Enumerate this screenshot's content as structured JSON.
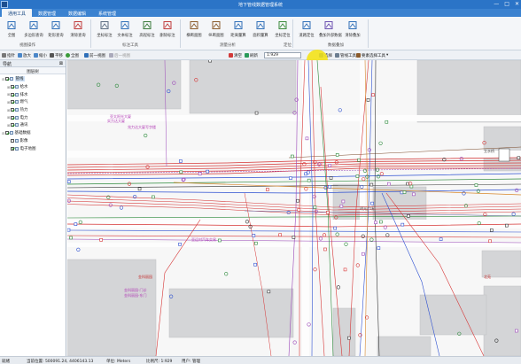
{
  "window": {
    "title": "地下管线数据管理系统",
    "controls": [
      "—",
      "□",
      "✕"
    ]
  },
  "tabs": [
    {
      "label": "通用工具",
      "active": true
    },
    {
      "label": "数据管理",
      "active": false
    },
    {
      "label": "数据编辑",
      "active": false
    },
    {
      "label": "系统管理",
      "active": false
    }
  ],
  "ribbon": {
    "buttons": [
      {
        "label": "全图",
        "icon": "full-extent-icon"
      },
      {
        "label": "多边形查询",
        "icon": "polygon-query-icon"
      },
      {
        "label": "矩形查询",
        "icon": "rect-query-icon"
      },
      {
        "label": "清除查询",
        "icon": "clear-query-icon"
      },
      {
        "label": "坐标标注",
        "icon": "coord-label-icon"
      },
      {
        "label": "文本标注",
        "icon": "text-label-icon"
      },
      {
        "label": "高程标注",
        "icon": "elevation-label-icon"
      },
      {
        "label": "删除标注",
        "icon": "delete-label-icon"
      },
      {
        "label": "横断面图",
        "icon": "cross-section-icon"
      },
      {
        "label": "纵断面图",
        "icon": "profile-icon"
      },
      {
        "label": "距离量算",
        "icon": "distance-measure-icon"
      },
      {
        "label": "面积量算",
        "icon": "area-measure-icon"
      },
      {
        "label": "坐标定位",
        "icon": "coord-locate-icon"
      },
      {
        "label": "道路定位",
        "icon": "road-locate-icon"
      },
      {
        "label": "叠加外部数据",
        "icon": "overlay-data-icon"
      },
      {
        "label": "清除叠加",
        "icon": "clear-overlay-icon"
      }
    ],
    "groups": [
      "视图操作",
      "标注工具",
      "测量分析",
      "定位",
      "数据叠加"
    ]
  },
  "map_toolbar": {
    "items": [
      "指针",
      "放大",
      "缩小",
      "平移",
      "全图",
      "前一视图",
      "后一视图",
      "清空",
      "刷新"
    ],
    "scale_value": "1:929",
    "right_items": [
      "选择",
      "管线工具",
      "要素选择工具"
    ]
  },
  "nav": {
    "title": "导航",
    "pin": "⊠",
    "subtitle": "图层树",
    "tree": [
      {
        "label": "管线",
        "level": 0,
        "exp": "⊟",
        "checked": true,
        "selected": true
      },
      {
        "label": "给水",
        "level": 1,
        "exp": "⊞",
        "checked": true
      },
      {
        "label": "排水",
        "level": 1,
        "exp": "⊞",
        "checked": true
      },
      {
        "label": "燃气",
        "level": 1,
        "exp": "⊞",
        "checked": true
      },
      {
        "label": "热力",
        "level": 1,
        "exp": "⊞",
        "checked": true
      },
      {
        "label": "电力",
        "level": 1,
        "exp": "⊞",
        "checked": true
      },
      {
        "label": "通讯",
        "level": 1,
        "exp": "⊞",
        "checked": true
      },
      {
        "label": "基础数据",
        "level": 0,
        "exp": "⊟",
        "checked": true
      },
      {
        "label": "影像",
        "level": 1,
        "exp": "",
        "checked": false
      },
      {
        "label": "电子地图",
        "level": 1,
        "exp": "",
        "checked": true
      }
    ]
  },
  "map": {
    "labels": [
      {
        "text": "亚太阳光大厦",
        "cls": "p"
      },
      {
        "text": "实力达大厦",
        "cls": "p"
      },
      {
        "text": "兆力达大厦写字楼",
        "cls": "p"
      },
      {
        "text": "明光广场",
        "cls": ""
      },
      {
        "text": "亚运村汽车交易",
        "cls": "p"
      },
      {
        "text": "金科丽园",
        "cls": "r"
      },
      {
        "text": "金科丽园-门诊",
        "cls": "p"
      },
      {
        "text": "金科丽园-东门",
        "cls": "p"
      },
      {
        "text": "立水桥",
        "cls": ""
      },
      {
        "text": "北苑",
        "cls": "r"
      }
    ]
  },
  "status": {
    "ready": "就绪",
    "coords": "当前位置: 500091.24, 4406143.13",
    "unit": "单位: Meters",
    "scale": "比例尺: 1:929",
    "user": "用户: 管理"
  }
}
